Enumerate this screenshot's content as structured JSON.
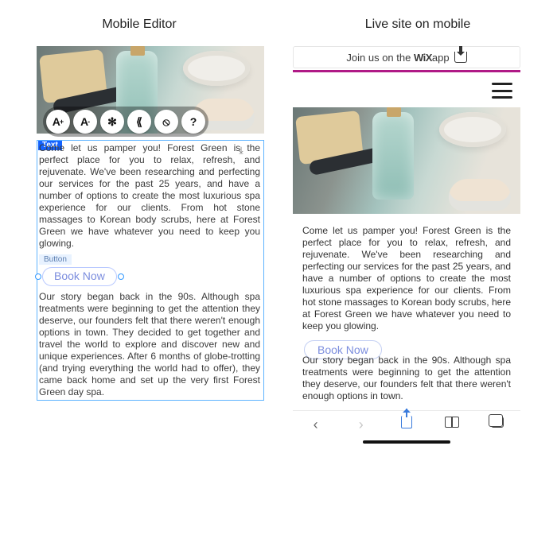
{
  "labels": {
    "editor": "Mobile Editor",
    "live": "Live site on mobile"
  },
  "editor": {
    "textTag": "Text",
    "toolbar": {
      "increaseFont": "A",
      "increaseFontSup": "+",
      "decreaseFont": "A",
      "decreaseFontSup": "-",
      "settings": "✻",
      "align": "⟪",
      "hide": "⦸",
      "help": "?"
    },
    "paragraph1": "Come let us pamper you! Forest Green is the perfect place for you to relax, refresh, and rejuvenate. We've been researching and perfecting our services for the past 25 years, and have a number of options to create the most luxurious spa experience for our clients. From hot stone massages to Korean body scrubs, here at Forest Green we have whatever you need to keep you glowing.",
    "buttonTag": "Button",
    "bookNow": "Book Now",
    "paragraph2": "Our story began back in the 90s. Although spa treatments were beginning to get the attention they deserve, our founders felt that there weren't enough options in town. They decided to get together and travel the world to explore and discover new and unique experiences. After 6 months of globe-trotting (and trying everything the world had to offer), they came back home and set up the very first Forest Green day spa."
  },
  "live": {
    "joinBar": {
      "prefix": "Join us on the ",
      "brand": "WiX",
      "suffix": "app"
    },
    "paragraph1": "Come let us pamper you! Forest Green is the perfect place for you to relax, refresh, and rejuvenate. We've been researching and perfecting our services for the past 25 years, and have a number of options to create the most luxurious spa experience for our clients. From hot stone massages to Korean body scrubs, here at Forest Green we have whatever you need to keep you glowing.",
    "bookNow": "Book Now",
    "paragraph2": "Our story began back in the 90s. Although spa treatments were beginning to get the attention they deserve, our founders felt that there weren't enough options in town."
  }
}
